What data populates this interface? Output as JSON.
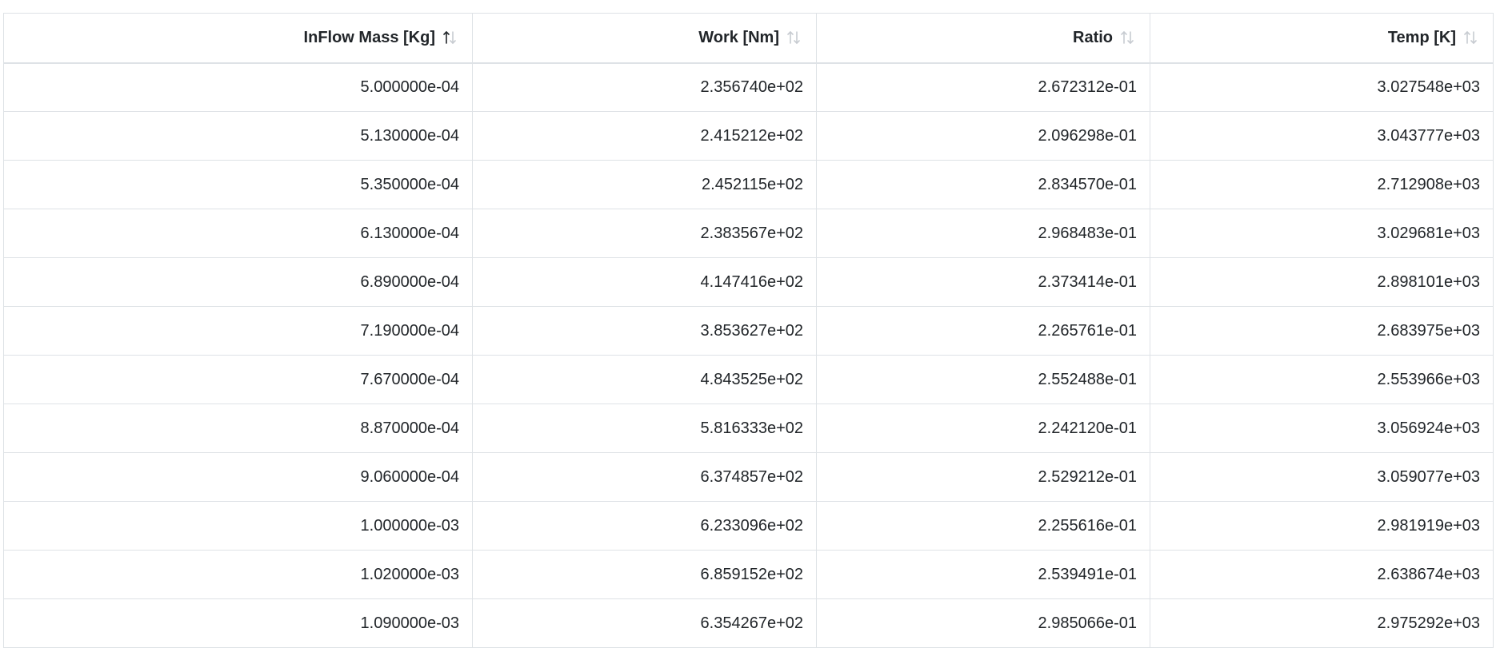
{
  "table": {
    "columns": [
      {
        "label": "InFlow Mass [Kg]",
        "sort": "asc"
      },
      {
        "label": "Work [Nm]",
        "sort": "none"
      },
      {
        "label": "Ratio",
        "sort": "none"
      },
      {
        "label": "Temp [K]",
        "sort": "none"
      }
    ],
    "rows": [
      [
        "5.000000e-04",
        "2.356740e+02",
        "2.672312e-01",
        "3.027548e+03"
      ],
      [
        "5.130000e-04",
        "2.415212e+02",
        "2.096298e-01",
        "3.043777e+03"
      ],
      [
        "5.350000e-04",
        "2.452115e+02",
        "2.834570e-01",
        "2.712908e+03"
      ],
      [
        "6.130000e-04",
        "2.383567e+02",
        "2.968483e-01",
        "3.029681e+03"
      ],
      [
        "6.890000e-04",
        "4.147416e+02",
        "2.373414e-01",
        "2.898101e+03"
      ],
      [
        "7.190000e-04",
        "3.853627e+02",
        "2.265761e-01",
        "2.683975e+03"
      ],
      [
        "7.670000e-04",
        "4.843525e+02",
        "2.552488e-01",
        "2.553966e+03"
      ],
      [
        "8.870000e-04",
        "5.816333e+02",
        "2.242120e-01",
        "3.056924e+03"
      ],
      [
        "9.060000e-04",
        "6.374857e+02",
        "2.529212e-01",
        "3.059077e+03"
      ],
      [
        "1.000000e-03",
        "6.233096e+02",
        "2.255616e-01",
        "2.981919e+03"
      ],
      [
        "1.020000e-03",
        "6.859152e+02",
        "2.539491e-01",
        "2.638674e+03"
      ],
      [
        "1.090000e-03",
        "6.354267e+02",
        "2.985066e-01",
        "2.975292e+03"
      ]
    ]
  },
  "colors": {
    "text": "#212529",
    "border": "#dee2e6",
    "sort_active": "#212529",
    "sort_inactive": "#c7cbd1"
  },
  "icons": {
    "sort": "sort-arrows-icon"
  }
}
